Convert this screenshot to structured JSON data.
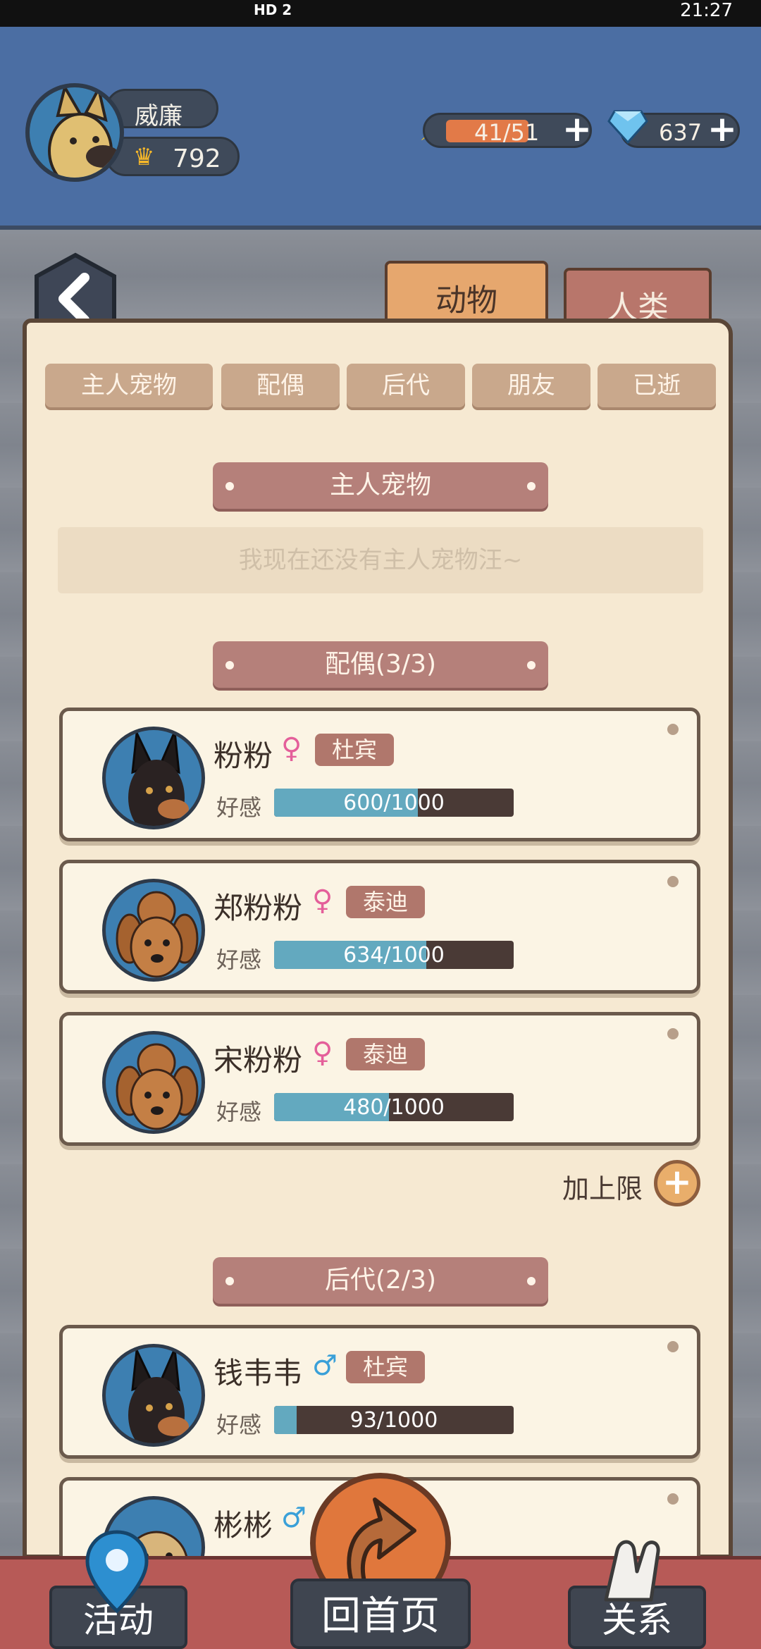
{
  "status_bar": {
    "left_badge": "HD 2",
    "time": "21:27"
  },
  "header": {
    "player_name": "威廉",
    "score": "792",
    "energy": "41/51",
    "energy_fraction": 0.8,
    "gems": "637",
    "plus": "+",
    "crown_icon": "crown-icon"
  },
  "tabs": {
    "animal": "动物",
    "human": "人类"
  },
  "subtabs": [
    "主人宠物",
    "配偶",
    "后代",
    "朋友",
    "已逝"
  ],
  "sections": {
    "owner_pets": {
      "title": "主人宠物",
      "empty_text": "我现在还没有主人宠物汪~"
    },
    "spouses": {
      "title": "配偶(3/3)"
    },
    "offspring": {
      "title": "后代(2/3)"
    }
  },
  "affection_label": "好感",
  "cards": [
    {
      "name": "粉粉",
      "gender": "♀",
      "breed": "杜宾",
      "affection": "600/1000",
      "fraction": 0.6,
      "dog": "doberman"
    },
    {
      "name": "郑粉粉",
      "gender": "♀",
      "breed": "泰迪",
      "affection": "634/1000",
      "fraction": 0.634,
      "dog": "poodle"
    },
    {
      "name": "宋粉粉",
      "gender": "♀",
      "breed": "泰迪",
      "affection": "480/1000",
      "fraction": 0.48,
      "dog": "poodle"
    },
    {
      "name": "钱韦韦",
      "gender": "♂",
      "breed": "杜宾",
      "affection": "93/1000",
      "fraction": 0.093,
      "dog": "doberman"
    },
    {
      "name": "彬彬",
      "gender": "♂",
      "breed": "",
      "affection": "",
      "fraction": 0,
      "dog": "pug"
    }
  ],
  "add_limit": "加上限",
  "bottom_nav": {
    "activity": "活动",
    "home": "回首页",
    "relations": "关系"
  },
  "colors": {
    "female": "#e45f9a",
    "male": "#3aa0d8",
    "accent": "#e0773c"
  }
}
